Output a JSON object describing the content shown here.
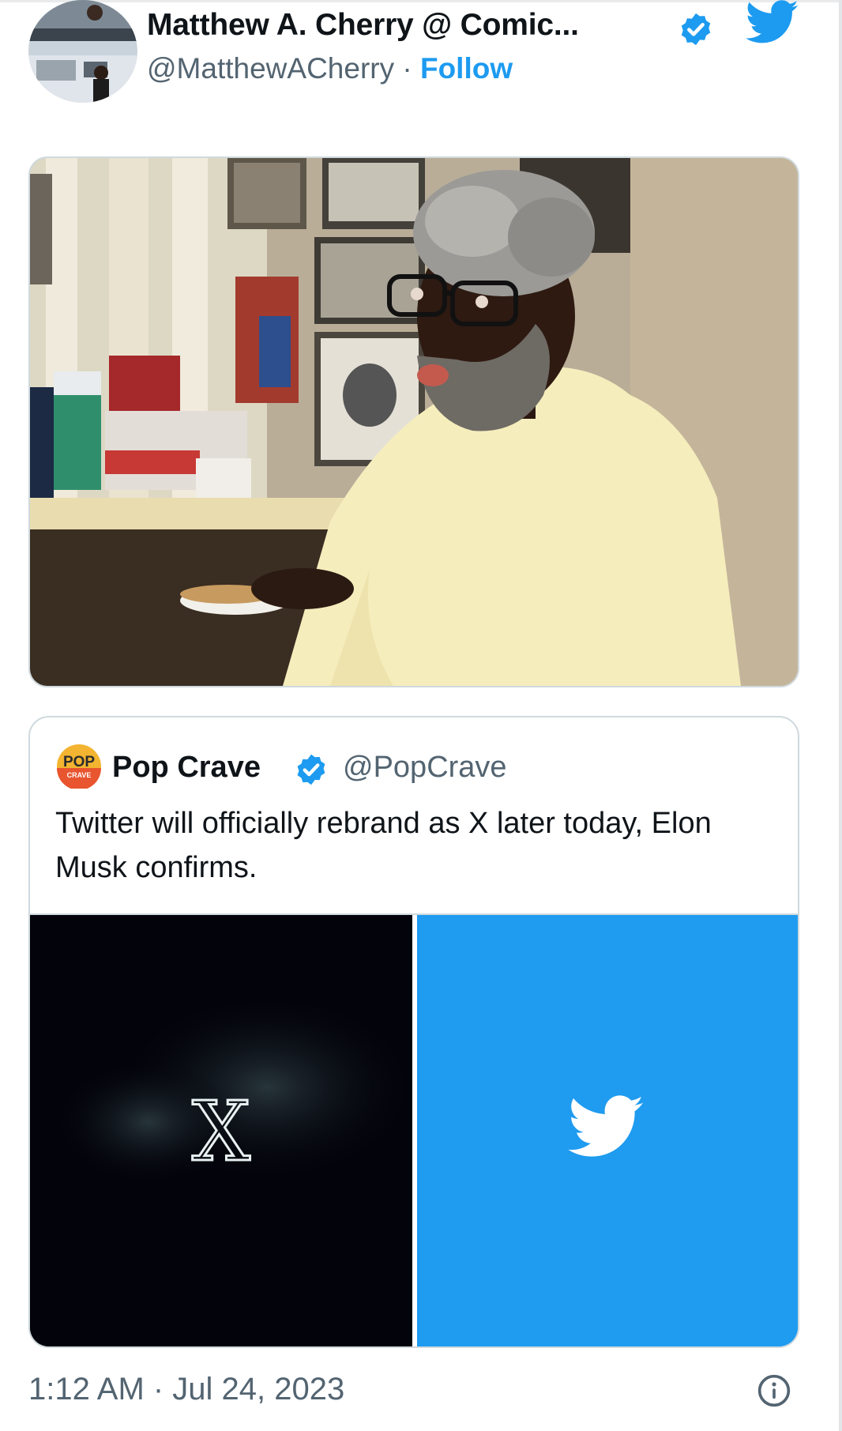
{
  "tweet": {
    "author": {
      "display_name": "Matthew A. Cherry @ Comic...",
      "handle": "@MatthewACherry",
      "separator": "·",
      "follow_label": "Follow"
    },
    "timestamp": "1:12 AM · Jul 24, 2023",
    "quoted_tweet": {
      "display_name": "Pop Crave",
      "handle": "@PopCrave",
      "avatar_text": "POP",
      "avatar_subtext": "CRAVE",
      "text": "Twitter will officially rebrand as X later today, Elon Musk confirms.",
      "media_left_glyph": "X"
    }
  },
  "colors": {
    "accent": "#1d9bf0",
    "secondary_text": "#536471",
    "border": "#cfd9de",
    "x_background": "#03040b",
    "twitter_blue": "#1f9bf0"
  },
  "icons": {
    "verified": "verified-badge-icon",
    "twitter": "twitter-bird-icon",
    "info": "info-icon"
  }
}
